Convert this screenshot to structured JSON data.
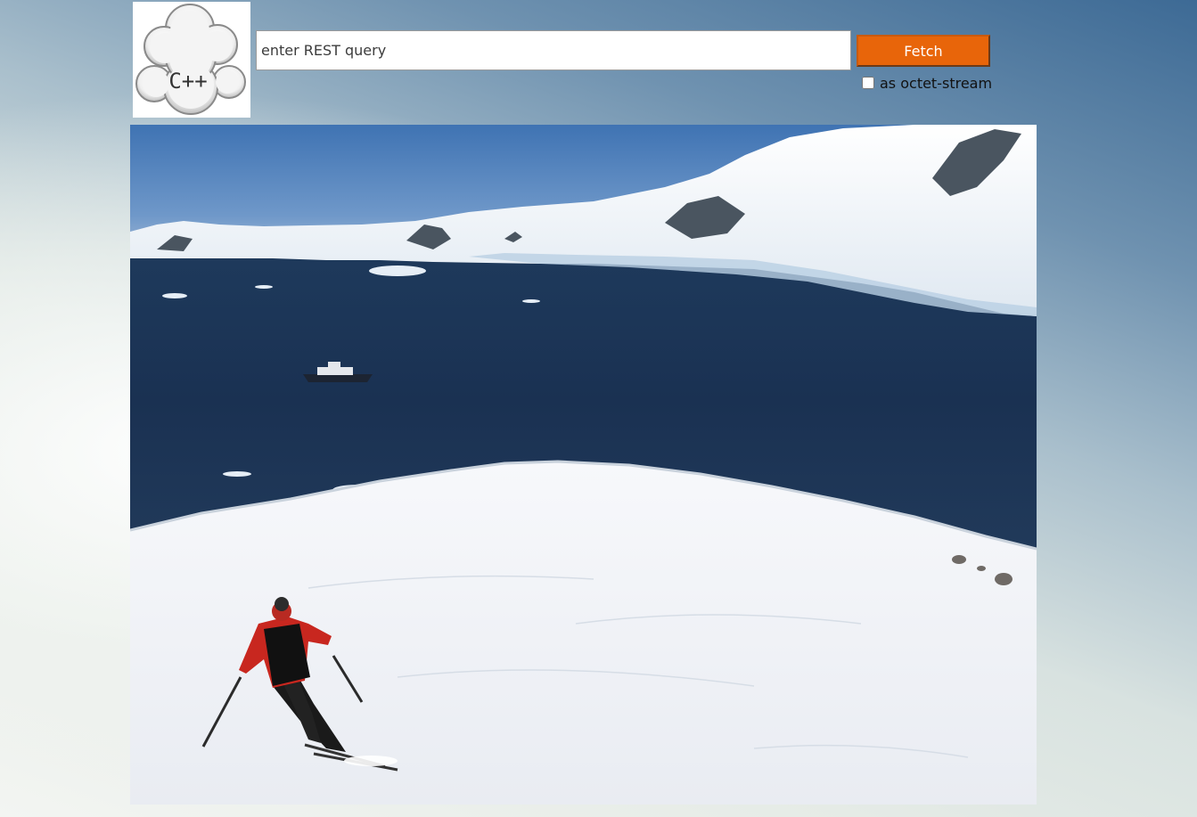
{
  "logo": {
    "text": "C++",
    "icon": "cloud-cpp-logo-icon"
  },
  "query": {
    "placeholder": "enter REST query",
    "value": ""
  },
  "fetch": {
    "label": "Fetch",
    "color": "#e8650a"
  },
  "octet_stream": {
    "label": "as octet-stream",
    "checked": false
  },
  "photo": {
    "icon": "skier-antarctic-bay-photo"
  }
}
